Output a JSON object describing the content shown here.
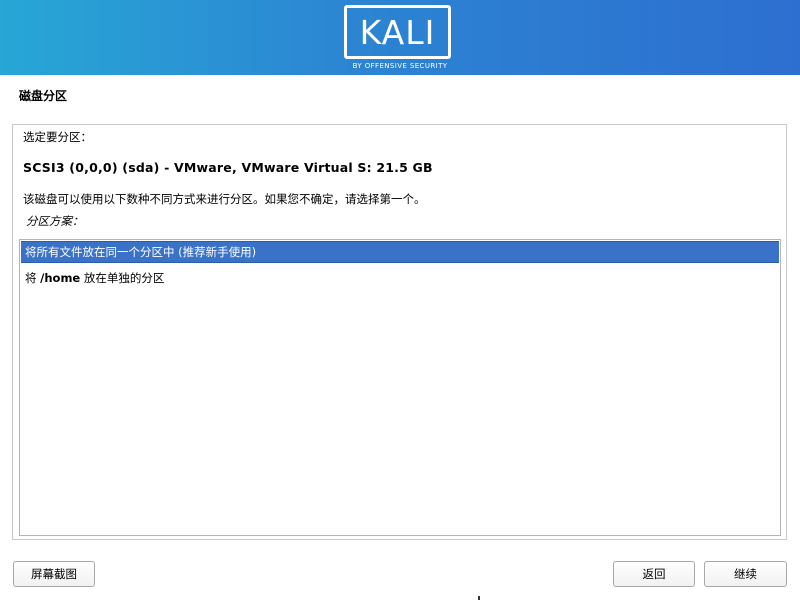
{
  "header": {
    "logo_text": "KALI",
    "tagline": "BY OFFENSIVE SECURITY",
    "gradient_start": "#27a7d6",
    "gradient_end": "#2d6fd0"
  },
  "page": {
    "title": "磁盘分区"
  },
  "panel": {
    "prompt": "选定要分区：",
    "disk": "SCSI3 (0,0,0) (sda) - VMware, VMware Virtual S: 21.5 GB",
    "description": "该磁盘可以使用以下数种不同方式来进行分区。如果您不确定，请选择第一个。",
    "scheme_label": "分区方案："
  },
  "schemes": [
    {
      "prefix": "将所有文件放在同一个分区中 (推荐新手使用)",
      "bold": "",
      "suffix": "",
      "selected": true
    },
    {
      "prefix": "将 ",
      "bold": "/home",
      "suffix": " 放在单独的分区",
      "selected": false
    }
  ],
  "buttons": {
    "screenshot": "屏幕截图",
    "back": "返回",
    "continue": "继续"
  },
  "colors": {
    "selection": "#3a72c8"
  }
}
